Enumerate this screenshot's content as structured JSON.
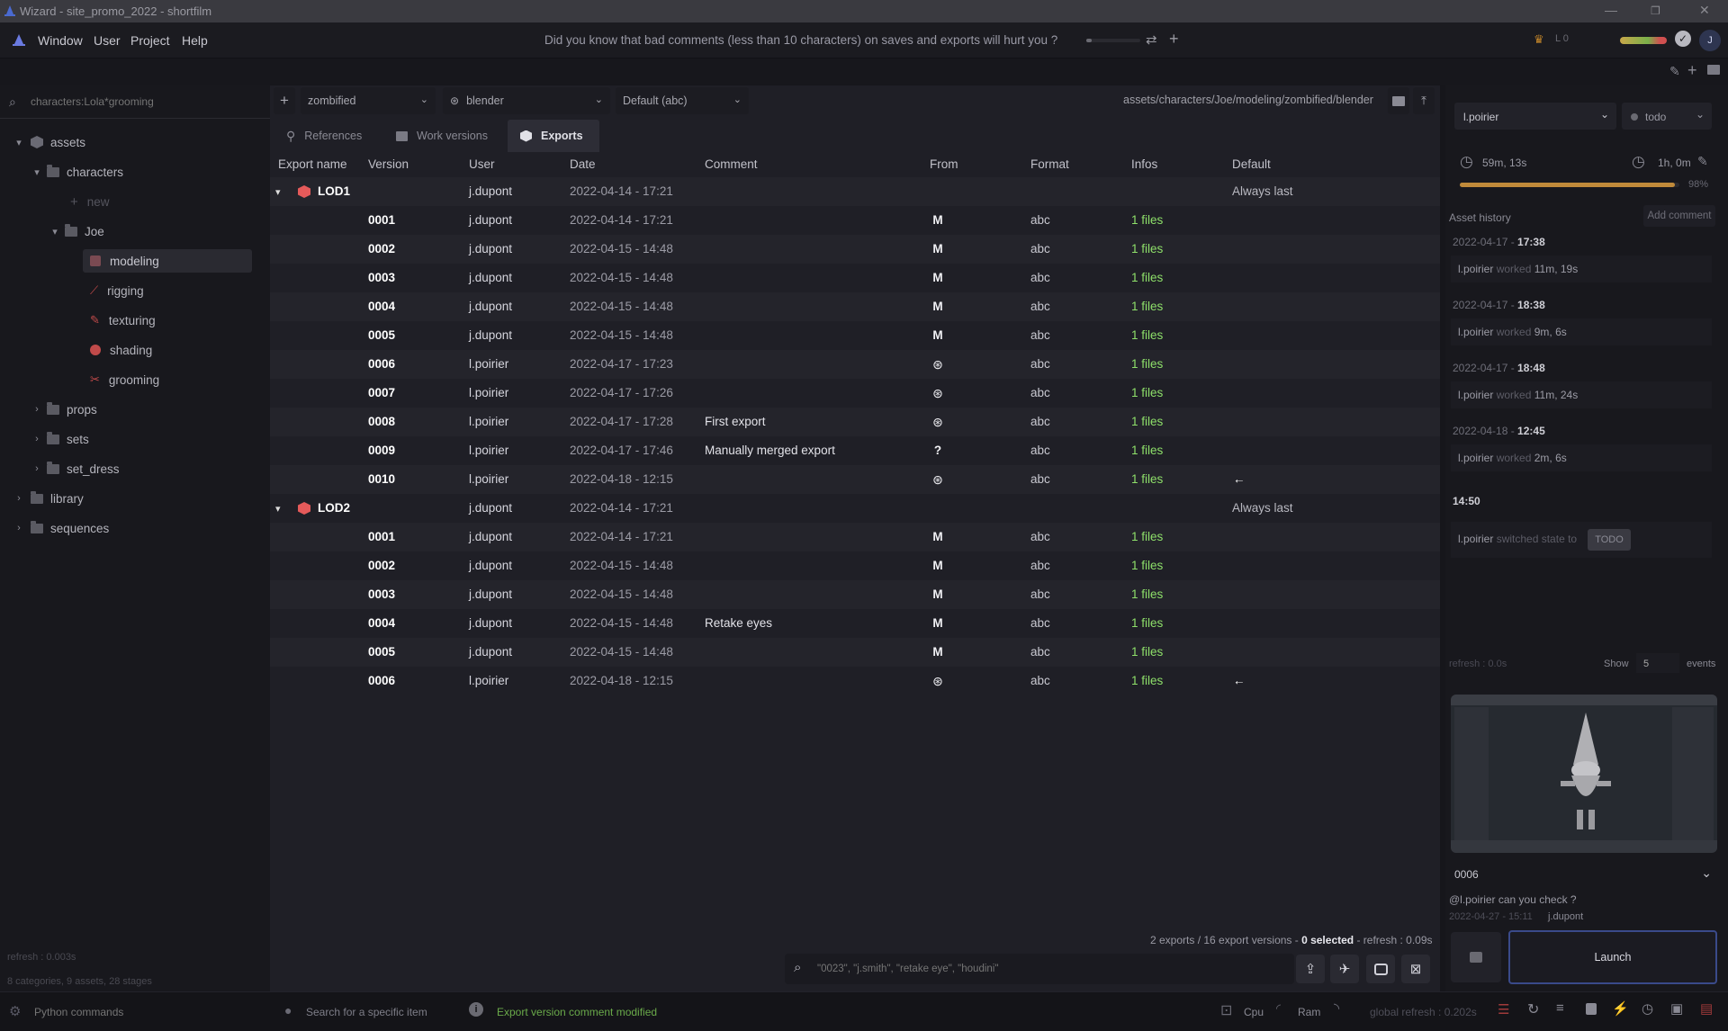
{
  "window": {
    "title": "Wizard - site_promo_2022 - shortfilm"
  },
  "menu": {
    "items": [
      "Window",
      "User",
      "Project",
      "Help"
    ],
    "tip": "Did you know that bad comments (less than 10 characters) on saves and exports will hurt you ?"
  },
  "topright": {
    "level": "L 0",
    "avatar": "J"
  },
  "sidebar": {
    "search_placeholder": "characters:Lola*grooming",
    "tree": {
      "assets": "assets",
      "characters": "characters",
      "new": "new",
      "joe": "Joe",
      "modeling": "modeling",
      "rigging": "rigging",
      "texturing": "texturing",
      "shading": "shading",
      "grooming": "grooming",
      "props": "props",
      "sets": "sets",
      "set_dress": "set_dress",
      "library": "library",
      "sequences": "sequences"
    },
    "refresh": "refresh : 0.003s",
    "summary": "8 categories, 9 assets, 28 stages"
  },
  "toolbar": {
    "variant": "zombified",
    "software": "blender",
    "export_format": "Default (abc)",
    "path": "assets/characters/Joe/modeling/zombified/blender"
  },
  "tabs": {
    "references": "References",
    "work_versions": "Work versions",
    "exports": "Exports"
  },
  "table": {
    "headers": {
      "export_name": "Export name",
      "version": "Version",
      "user": "User",
      "date": "Date",
      "comment": "Comment",
      "from": "From",
      "format": "Format",
      "infos": "Infos",
      "default": "Default"
    },
    "groups": [
      {
        "name": "LOD1",
        "user": "j.dupont",
        "date": "2022-04-14 - 17:21",
        "default": "Always last",
        "rows": [
          {
            "version": "0001",
            "user": "j.dupont",
            "date": "2022-04-14 - 17:21",
            "comment": "",
            "from": "M",
            "format": "abc",
            "infos": "1 files",
            "default": ""
          },
          {
            "version": "0002",
            "user": "j.dupont",
            "date": "2022-04-15 - 14:48",
            "comment": "",
            "from": "M",
            "format": "abc",
            "infos": "1 files",
            "default": ""
          },
          {
            "version": "0003",
            "user": "j.dupont",
            "date": "2022-04-15 - 14:48",
            "comment": "",
            "from": "M",
            "format": "abc",
            "infos": "1 files",
            "default": ""
          },
          {
            "version": "0004",
            "user": "j.dupont",
            "date": "2022-04-15 - 14:48",
            "comment": "",
            "from": "M",
            "format": "abc",
            "infos": "1 files",
            "default": ""
          },
          {
            "version": "0005",
            "user": "j.dupont",
            "date": "2022-04-15 - 14:48",
            "comment": "",
            "from": "M",
            "format": "abc",
            "infos": "1 files",
            "default": ""
          },
          {
            "version": "0006",
            "user": "l.poirier",
            "date": "2022-04-17 - 17:23",
            "comment": "",
            "from": "blender",
            "format": "abc",
            "infos": "1 files",
            "default": ""
          },
          {
            "version": "0007",
            "user": "l.poirier",
            "date": "2022-04-17 - 17:26",
            "comment": "",
            "from": "blender",
            "format": "abc",
            "infos": "1 files",
            "default": ""
          },
          {
            "version": "0008",
            "user": "l.poirier",
            "date": "2022-04-17 - 17:28",
            "comment": "First export",
            "from": "blender",
            "format": "abc",
            "infos": "1 files",
            "default": ""
          },
          {
            "version": "0009",
            "user": "l.poirier",
            "date": "2022-04-17 - 17:46",
            "comment": "Manually merged export",
            "from": "?",
            "format": "abc",
            "infos": "1 files",
            "default": ""
          },
          {
            "version": "0010",
            "user": "l.poirier",
            "date": "2022-04-18 - 12:15",
            "comment": "",
            "from": "blender",
            "format": "abc",
            "infos": "1 files",
            "default": "←"
          }
        ]
      },
      {
        "name": "LOD2",
        "user": "j.dupont",
        "date": "2022-04-14 - 17:21",
        "default": "Always last",
        "rows": [
          {
            "version": "0001",
            "user": "j.dupont",
            "date": "2022-04-14 - 17:21",
            "comment": "",
            "from": "M",
            "format": "abc",
            "infos": "1 files",
            "default": ""
          },
          {
            "version": "0002",
            "user": "j.dupont",
            "date": "2022-04-15 - 14:48",
            "comment": "",
            "from": "M",
            "format": "abc",
            "infos": "1 files",
            "default": ""
          },
          {
            "version": "0003",
            "user": "j.dupont",
            "date": "2022-04-15 - 14:48",
            "comment": "",
            "from": "M",
            "format": "abc",
            "infos": "1 files",
            "default": ""
          },
          {
            "version": "0004",
            "user": "j.dupont",
            "date": "2022-04-15 - 14:48",
            "comment": "Retake eyes",
            "from": "M",
            "format": "abc",
            "infos": "1 files",
            "default": ""
          },
          {
            "version": "0005",
            "user": "j.dupont",
            "date": "2022-04-15 - 14:48",
            "comment": "",
            "from": "M",
            "format": "abc",
            "infos": "1 files",
            "default": ""
          },
          {
            "version": "0006",
            "user": "l.poirier",
            "date": "2022-04-18 - 12:15",
            "comment": "",
            "from": "blender",
            "format": "abc",
            "infos": "1 files",
            "default": "←"
          }
        ]
      }
    ],
    "footer": {
      "summary_pre": "2 exports / 16 export versions - ",
      "selected": "0 selected",
      "summary_post": " - refresh : 0.09s"
    },
    "search_placeholder": "\"0023\", \"j.smith\", \"retake eye\", \"houdini\""
  },
  "right": {
    "user": "l.poirier",
    "state": "todo",
    "time_spent": "59m, 13s",
    "estimated": "1h, 0m",
    "progress": 0.98,
    "progress_label": "98%",
    "asset_history": "Asset history",
    "add_comment": "Add comment",
    "history": [
      {
        "date": "2022-04-17 - ",
        "time": "17:38",
        "user": "l.poirier",
        "action": "worked",
        "detail": "11m, 19s"
      },
      {
        "date": "2022-04-17 - ",
        "time": "18:38",
        "user": "l.poirier",
        "action": "worked",
        "detail": "9m, 6s"
      },
      {
        "date": "2022-04-17 - ",
        "time": "18:48",
        "user": "l.poirier",
        "action": "worked",
        "detail": "11m, 24s"
      },
      {
        "date": "2022-04-18 - ",
        "time": "12:45",
        "user": "l.poirier",
        "action": "worked",
        "detail": "2m, 6s"
      }
    ],
    "last_time": "14:50",
    "last_user": "l.poirier",
    "last_action": "switched state to",
    "last_badge": "TODO",
    "refresh": "refresh : 0.0s",
    "show": "Show",
    "show_count": "5",
    "events": "events",
    "version": "0006",
    "comment_text": "@l.poirier can you check ?",
    "comment_date": "2022-04-27 - 15:11",
    "comment_user": "j.dupont",
    "launch": "Launch"
  },
  "status": {
    "python": "Python commands",
    "search_tip": "Search for a specific item",
    "message": "Export version comment modified",
    "cpu": "Cpu",
    "ram": "Ram",
    "global_refresh": "global refresh : 0.202s"
  },
  "colors": {
    "accent_red": "#e55a5a",
    "infos_green": "#8ee06a",
    "message_green": "#6aaa4a"
  }
}
